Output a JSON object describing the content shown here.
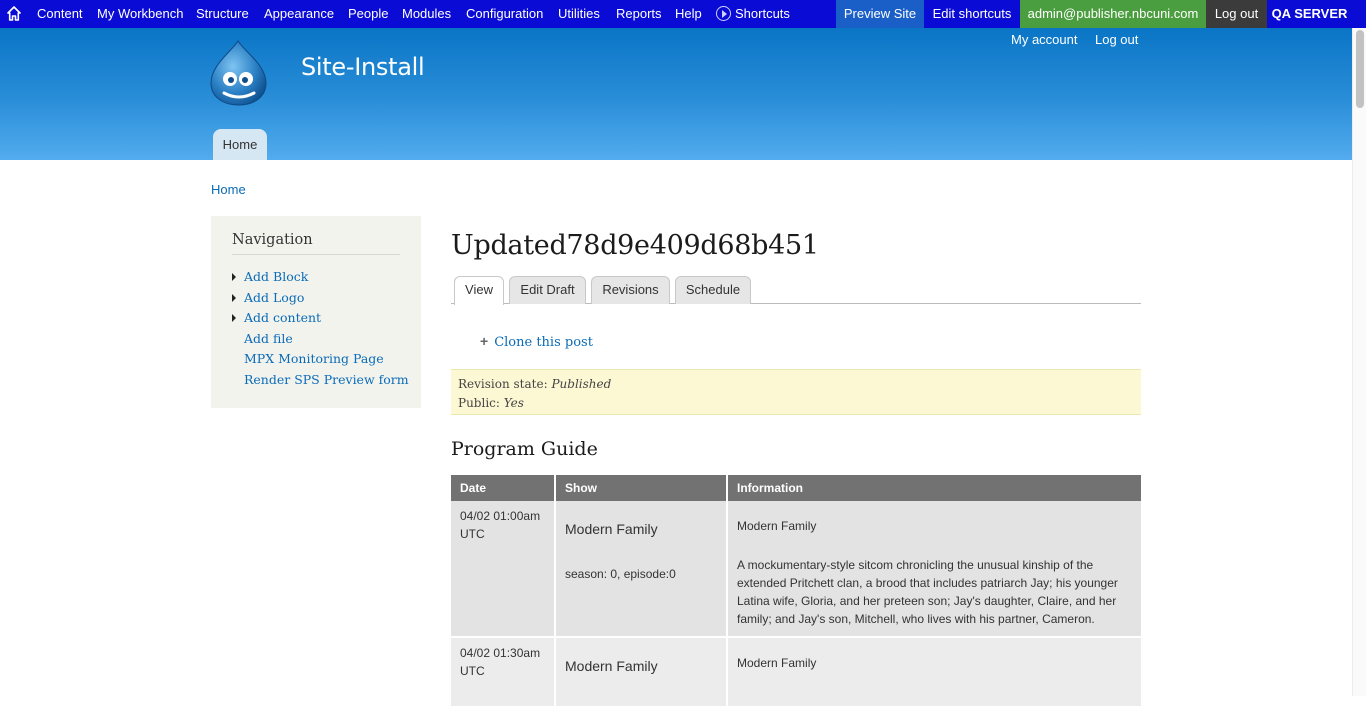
{
  "toolbar": {
    "items": [
      "Content",
      "My Workbench",
      "Structure",
      "Appearance",
      "People",
      "Modules",
      "Configuration",
      "Utilities",
      "Reports",
      "Help"
    ],
    "shortcuts_label": "Shortcuts",
    "preview_site": "Preview Site",
    "edit_shortcuts": "Edit shortcuts",
    "user_email": "admin@publisher.nbcuni.com",
    "logout": "Log out",
    "server": "QA SERVER",
    "colors": {
      "bar": "#0b0bd6",
      "user": "#4b9e3f",
      "logout": "#3b3b3b",
      "preview": "#1a5fc8"
    }
  },
  "header": {
    "site_name": "Site-Install",
    "logo_icon": "drupal-drop-logo",
    "secondary_menu": [
      "My account",
      "Log out"
    ],
    "main_tab": "Home"
  },
  "breadcrumb": {
    "home": "Home"
  },
  "sidebar": {
    "title": "Navigation",
    "items": [
      {
        "label": "Add Block",
        "type": "collapsed"
      },
      {
        "label": "Add Logo",
        "type": "collapsed"
      },
      {
        "label": "Add content",
        "type": "collapsed"
      },
      {
        "label": "Add file",
        "type": "leaf"
      },
      {
        "label": "MPX Monitoring Page",
        "type": "leaf"
      },
      {
        "label": "Render SPS Preview form",
        "type": "leaf"
      }
    ]
  },
  "node": {
    "title": "Updated78d9e409d68b451",
    "tabs": [
      "View",
      "Edit Draft",
      "Revisions",
      "Schedule"
    ],
    "clone_link": "Clone this post",
    "revision_state_label": "Revision state:",
    "revision_state_value": "Published",
    "public_label": "Public:",
    "public_value": "Yes"
  },
  "program_guide": {
    "title": "Program Guide",
    "columns": [
      "Date",
      "Show",
      "Information"
    ],
    "rows": [
      {
        "date": "04/02 01:00am",
        "tz": "UTC",
        "show": "Modern Family",
        "episode": "season: 0, episode:0",
        "info_title": "Modern Family",
        "info_desc": "A mockumentary-style sitcom chronicling the unusual kinship of the extended Pritchett clan, a brood that includes patriarch Jay; his younger Latina wife, Gloria, and her preteen son; Jay's daughter, Claire, and her family; and Jay's son, Mitchell, who lives with his partner, Cameron."
      },
      {
        "date": "04/02 01:30am",
        "tz": "UTC",
        "show": "Modern Family",
        "info_title": "Modern Family"
      }
    ]
  }
}
